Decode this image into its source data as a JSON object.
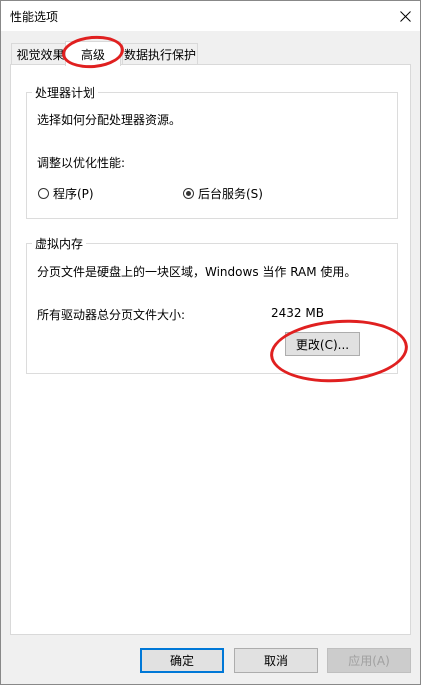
{
  "window": {
    "title": "性能选项",
    "close_icon": "close-icon"
  },
  "tabs": [
    {
      "label": "视觉效果"
    },
    {
      "label": "高级",
      "active": true
    },
    {
      "label": "数据执行保护"
    }
  ],
  "processor_group": {
    "legend": "处理器计划",
    "description": "选择如何分配处理器资源。",
    "adjust_label": "调整以优化性能:",
    "options": [
      {
        "label": "程序(P)",
        "selected": false
      },
      {
        "label": "后台服务(S)",
        "selected": true
      }
    ]
  },
  "virtual_memory_group": {
    "legend": "虚拟内存",
    "description": "分页文件是硬盘上的一块区域，Windows 当作 RAM 使用。",
    "total_label": "所有驱动器总分页文件大小:",
    "total_value": "2432 MB",
    "change_button": "更改(C)..."
  },
  "footer": {
    "ok": "确定",
    "cancel": "取消",
    "apply": "应用(A)"
  },
  "annotation_color": "#e02020"
}
